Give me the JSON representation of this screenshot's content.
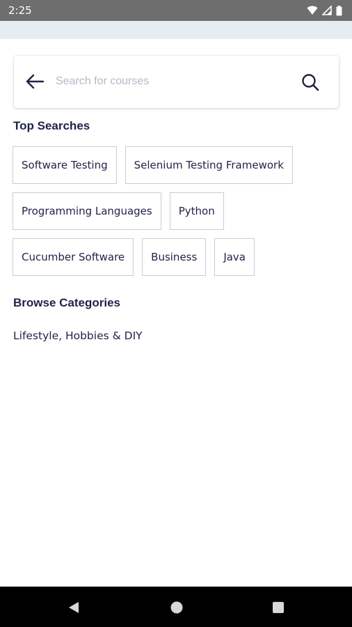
{
  "status_bar": {
    "time": "2:25",
    "icons": [
      "wifi-icon",
      "cell-signal-icon",
      "battery-icon"
    ]
  },
  "search": {
    "placeholder": "Search for courses",
    "value": "",
    "back_icon": "arrow-left-icon",
    "search_icon": "search-icon"
  },
  "top_searches": {
    "heading": "Top Searches",
    "tags": [
      "Software Testing",
      "Selenium Testing Framework",
      "Programming Languages",
      "Python",
      "Cucumber Software",
      "Business",
      "Java"
    ]
  },
  "browse_categories": {
    "heading": "Browse Categories",
    "items": [
      "Lifestyle, Hobbies & DIY"
    ]
  },
  "nav_bar": {
    "buttons": [
      "back-triangle-icon",
      "home-circle-icon",
      "recents-square-icon"
    ]
  },
  "colors": {
    "text_primary": "#1f2247",
    "placeholder": "#b5b9c7",
    "tag_border": "#c8ced4",
    "status_bar": "#6e6e6e",
    "top_strip": "#e4edf3",
    "nav_bar": "#000000"
  }
}
